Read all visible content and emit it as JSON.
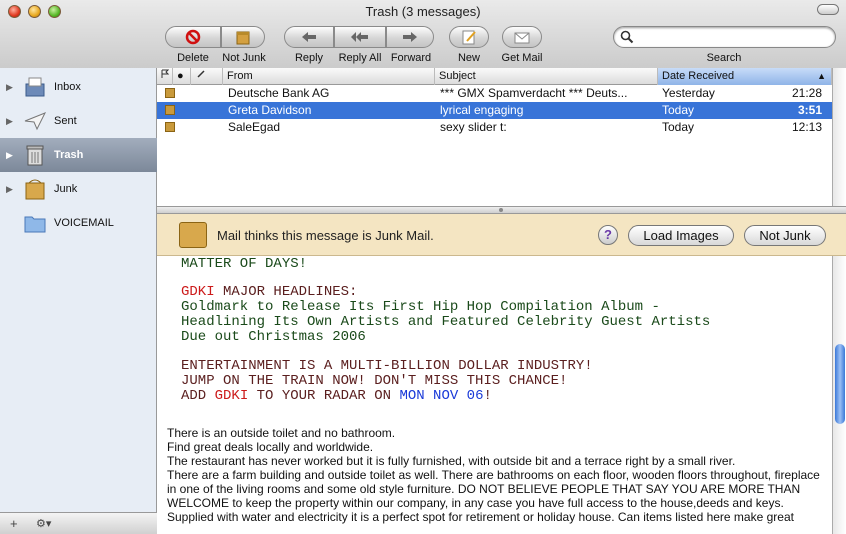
{
  "window": {
    "title": "Trash (3 messages)"
  },
  "toolbar": {
    "delete": "Delete",
    "not_junk": "Not Junk",
    "reply": "Reply",
    "reply_all": "Reply All",
    "forward": "Forward",
    "new": "New",
    "get_mail": "Get Mail",
    "search_label": "Search",
    "search_placeholder": ""
  },
  "sidebar": {
    "items": [
      {
        "label": "Inbox",
        "icon": "inbox-icon"
      },
      {
        "label": "Sent",
        "icon": "sent-icon"
      },
      {
        "label": "Trash",
        "icon": "trash-icon",
        "selected": true
      },
      {
        "label": "Junk",
        "icon": "junk-icon"
      },
      {
        "label": "VOICEMAIL",
        "icon": "folder-icon"
      }
    ],
    "add": "+",
    "action": "⚙▾"
  },
  "list": {
    "columns": {
      "from": "From",
      "subject": "Subject",
      "date": "Date Received"
    },
    "rows": [
      {
        "from": "Deutsche Bank AG",
        "subject": "*** GMX Spamverdacht *** Deuts...",
        "date": "Yesterday",
        "time": "21:28"
      },
      {
        "from": "Greta Davidson",
        "subject": "lyrical engaging",
        "date": "Today",
        "time": "3:51"
      },
      {
        "from": "SaleEgad",
        "subject": "sexy slider t:",
        "date": "Today",
        "time": "12:13"
      }
    ]
  },
  "banner": {
    "message": "Mail thinks this message is Junk Mail.",
    "help": "?",
    "load_images": "Load Images",
    "not_junk": "Not Junk"
  },
  "message": {
    "l1": "MATTER OF DAYS!",
    "l2a": "GDKI",
    "l2b": " MAJOR HEADLINES:",
    "l3": "Goldmark to Release Its First Hip Hop Compilation Album -",
    "l4": "Headlining Its Own Artists and Featured Celebrity Guest Artists",
    "l5": "Due out Christmas 2006",
    "l6": "ENTERTAINMENT IS A MULTI-BILLION DOLLAR INDUSTRY!",
    "l7": "JUMP ON THE TRAIN NOW! DON'T MISS THIS CHANCE!",
    "l8a": "ADD ",
    "l8b": "GDKI",
    "l8c": " TO YOUR RADAR ON ",
    "l8d": "MON NOV 06",
    "l8e": "!",
    "p1": "There is an outside toilet and no bathroom.",
    "p2": "Find great deals locally and worldwide.",
    "p3": "The restaurant has never worked but it is fully furnished, with outside bit and a terrace right by a small river.",
    "p4": "There are a farm building and outside toilet as well. There are bathrooms on each floor, wooden floors throughout, fireplace in one of the living rooms and some old style furniture. DO NOT BELIEVE PEOPLE THAT SAY YOU ARE MORE THAN WELCOME to keep the property within our company, in any case you have full access to the house,deeds and keys.",
    "p5": "Supplied with water and electricity it is a perfect spot for retirement or holiday house. Can items listed here make great"
  }
}
